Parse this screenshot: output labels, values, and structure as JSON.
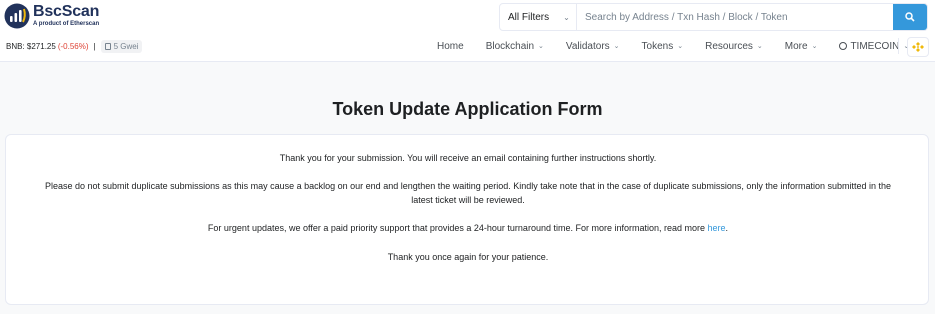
{
  "brand": {
    "name": "BscScan",
    "tagline": "A product of Etherscan"
  },
  "search": {
    "filter_label": "All Filters",
    "placeholder": "Search by Address / Txn Hash / Block / Token"
  },
  "ticker": {
    "price": "BNB: $271.25",
    "change": "(-0.56%)",
    "separator": "|",
    "gas": "5 Gwei"
  },
  "nav": {
    "items": [
      {
        "label": "Home",
        "dropdown": false
      },
      {
        "label": "Blockchain",
        "dropdown": true
      },
      {
        "label": "Validators",
        "dropdown": true
      },
      {
        "label": "Tokens",
        "dropdown": true
      },
      {
        "label": "Resources",
        "dropdown": true
      },
      {
        "label": "More",
        "dropdown": true
      }
    ],
    "user": "TIMECOIN"
  },
  "colors": {
    "accent": "#3498db",
    "negative": "#de4437",
    "brand_dark": "#21325b",
    "bnb_yellow": "#f0b90b"
  },
  "page": {
    "title": "Token Update Application Form"
  },
  "message": {
    "line1": "Thank you for your submission. You will receive an email containing further instructions shortly.",
    "line2a": "Please do not submit duplicate submissions as this may cause a backlog on our end and lengthen the waiting period. Kindly take note that in the case of duplicate submissions, only the information submitted in the",
    "line2b": "latest ticket will be reviewed.",
    "line3": "For urgent updates, we offer a paid priority support that provides a 24-hour turnaround time. For more information, read more",
    "link": "here",
    "line3_end": ".",
    "line4": "Thank you once again for your patience."
  }
}
